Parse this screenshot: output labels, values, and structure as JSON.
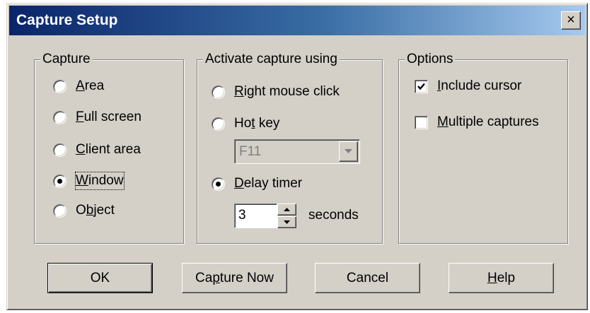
{
  "window": {
    "title": "Capture Setup",
    "close_label": "×"
  },
  "capture": {
    "legend": "Capture",
    "options": [
      {
        "pre": "",
        "key": "A",
        "post": "rea",
        "selected": false
      },
      {
        "pre": "",
        "key": "F",
        "post": "ull screen",
        "selected": false
      },
      {
        "pre": "",
        "key": "C",
        "post": "lient area",
        "selected": false
      },
      {
        "pre": "",
        "key": "W",
        "post": "indow",
        "selected": true
      },
      {
        "pre": "O",
        "key": "b",
        "post": "ject",
        "selected": false
      }
    ]
  },
  "activate": {
    "legend": "Activate capture using",
    "right_click": {
      "pre": "",
      "key": "R",
      "post": "ight mouse click",
      "selected": false
    },
    "hot_key": {
      "pre": "Ho",
      "key": "t",
      "post": " key",
      "selected": false
    },
    "hot_key_value": "F11",
    "delay_timer": {
      "pre": "",
      "key": "D",
      "post": "elay timer",
      "selected": true
    },
    "delay_value": "3",
    "delay_unit": "seconds"
  },
  "options": {
    "legend": "Options",
    "include_cursor": {
      "pre": "",
      "key": "I",
      "post": "nclude cursor",
      "checked": true
    },
    "multiple_captures": {
      "pre": "",
      "key": "M",
      "post": "ultiple captures",
      "checked": false
    }
  },
  "buttons": {
    "ok": {
      "pre": "OK",
      "key": "",
      "post": ""
    },
    "capture_now": {
      "pre": "Ca",
      "key": "p",
      "post": "ture Now"
    },
    "cancel": {
      "pre": "Cancel",
      "key": "",
      "post": ""
    },
    "help": {
      "pre": "",
      "key": "H",
      "post": "elp"
    }
  }
}
